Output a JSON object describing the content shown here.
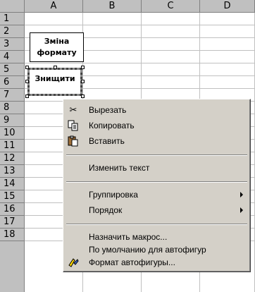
{
  "sheet": {
    "columns": [
      "A",
      "B",
      "C",
      "D"
    ],
    "rows": [
      "1",
      "2",
      "3",
      "4",
      "5",
      "6",
      "7",
      "8",
      "9",
      "10",
      "11",
      "12",
      "13",
      "14",
      "15",
      "16",
      "17",
      "18"
    ]
  },
  "shapes": {
    "format_shape_line1": "Зміна",
    "format_shape_line2": "формату",
    "delete_shape_label": "Знищити"
  },
  "context_menu": {
    "cut": "Вырезать",
    "copy": "Копировать",
    "paste": "Вставить",
    "edit_text": "Изменить текст",
    "grouping": "Группировка",
    "order": "Порядок",
    "assign_macro": "Назначить макрос...",
    "default_autoshape": "По умолчанию для автофигур",
    "format_autoshape": "Формат автофигуры..."
  },
  "icons": {
    "cut": "scissors-icon",
    "copy": "copy-icon",
    "paste": "clipboard-icon",
    "format": "format-brush-icon"
  }
}
